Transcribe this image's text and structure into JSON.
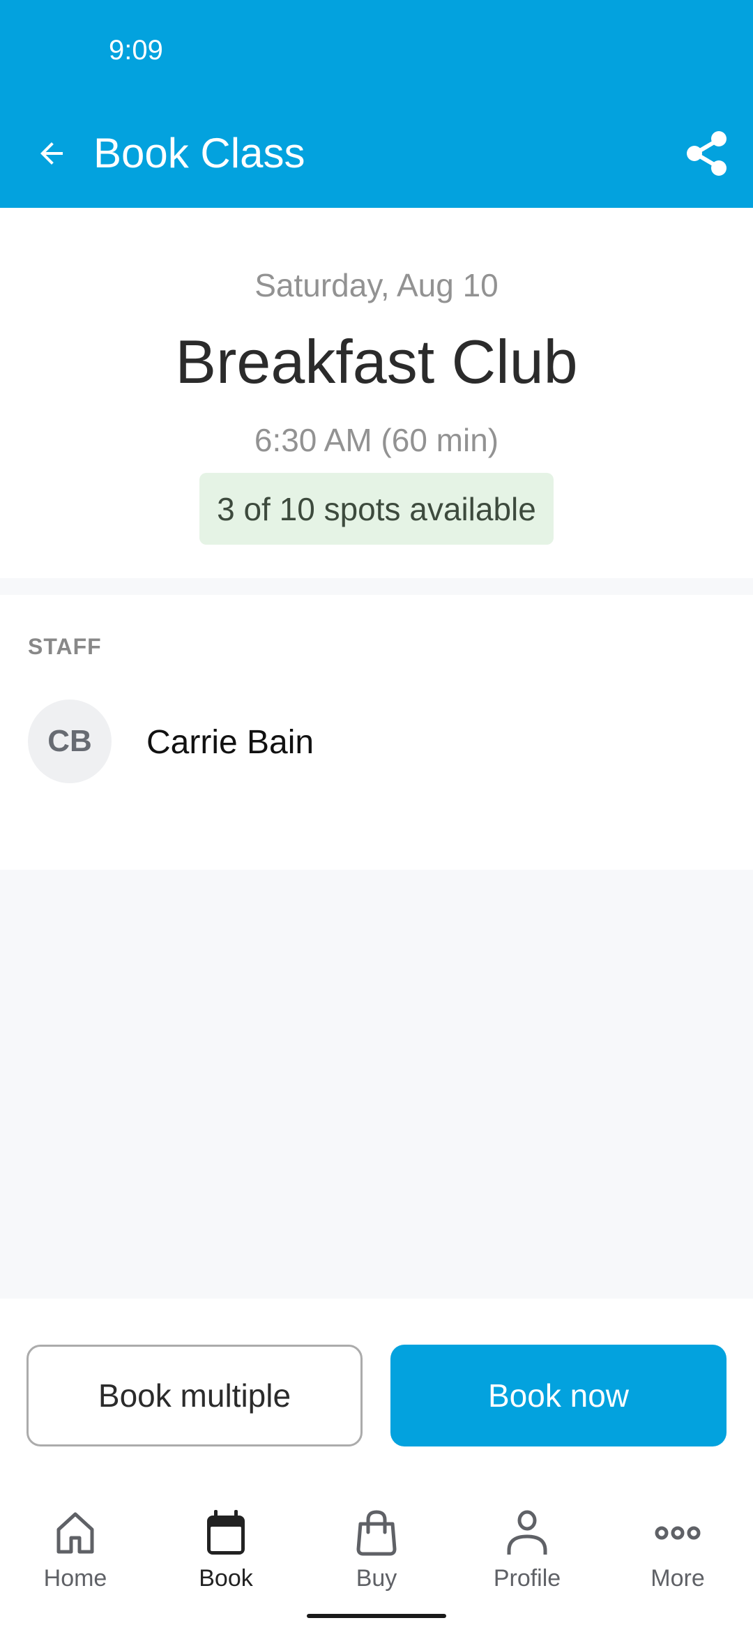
{
  "status_bar": {
    "time": "9:09"
  },
  "toolbar": {
    "title": "Book Class",
    "back_icon": "arrow-left-icon",
    "share_icon": "share-icon"
  },
  "class": {
    "date": "Saturday, Aug 10",
    "name": "Breakfast Club",
    "time": "6:30 AM (60 min)",
    "spots_text": "3 of 10 spots available",
    "spots_available": 3,
    "spots_total": 10
  },
  "staff": {
    "heading": "STAFF",
    "members": [
      {
        "initials": "CB",
        "name": "Carrie Bain"
      }
    ]
  },
  "actions": {
    "book_multiple_label": "Book multiple",
    "book_now_label": "Book now"
  },
  "bottom_nav": {
    "active": "Book",
    "items": [
      {
        "label": "Home",
        "icon": "home-icon"
      },
      {
        "label": "Book",
        "icon": "calendar-icon"
      },
      {
        "label": "Buy",
        "icon": "shopping-bag-icon"
      },
      {
        "label": "Profile",
        "icon": "person-icon"
      },
      {
        "label": "More",
        "icon": "more-dots-icon"
      }
    ]
  },
  "colors": {
    "brand": "#03A2DE",
    "badge_bg": "#E5F3E5",
    "page_gray": "#F7F8FA"
  }
}
